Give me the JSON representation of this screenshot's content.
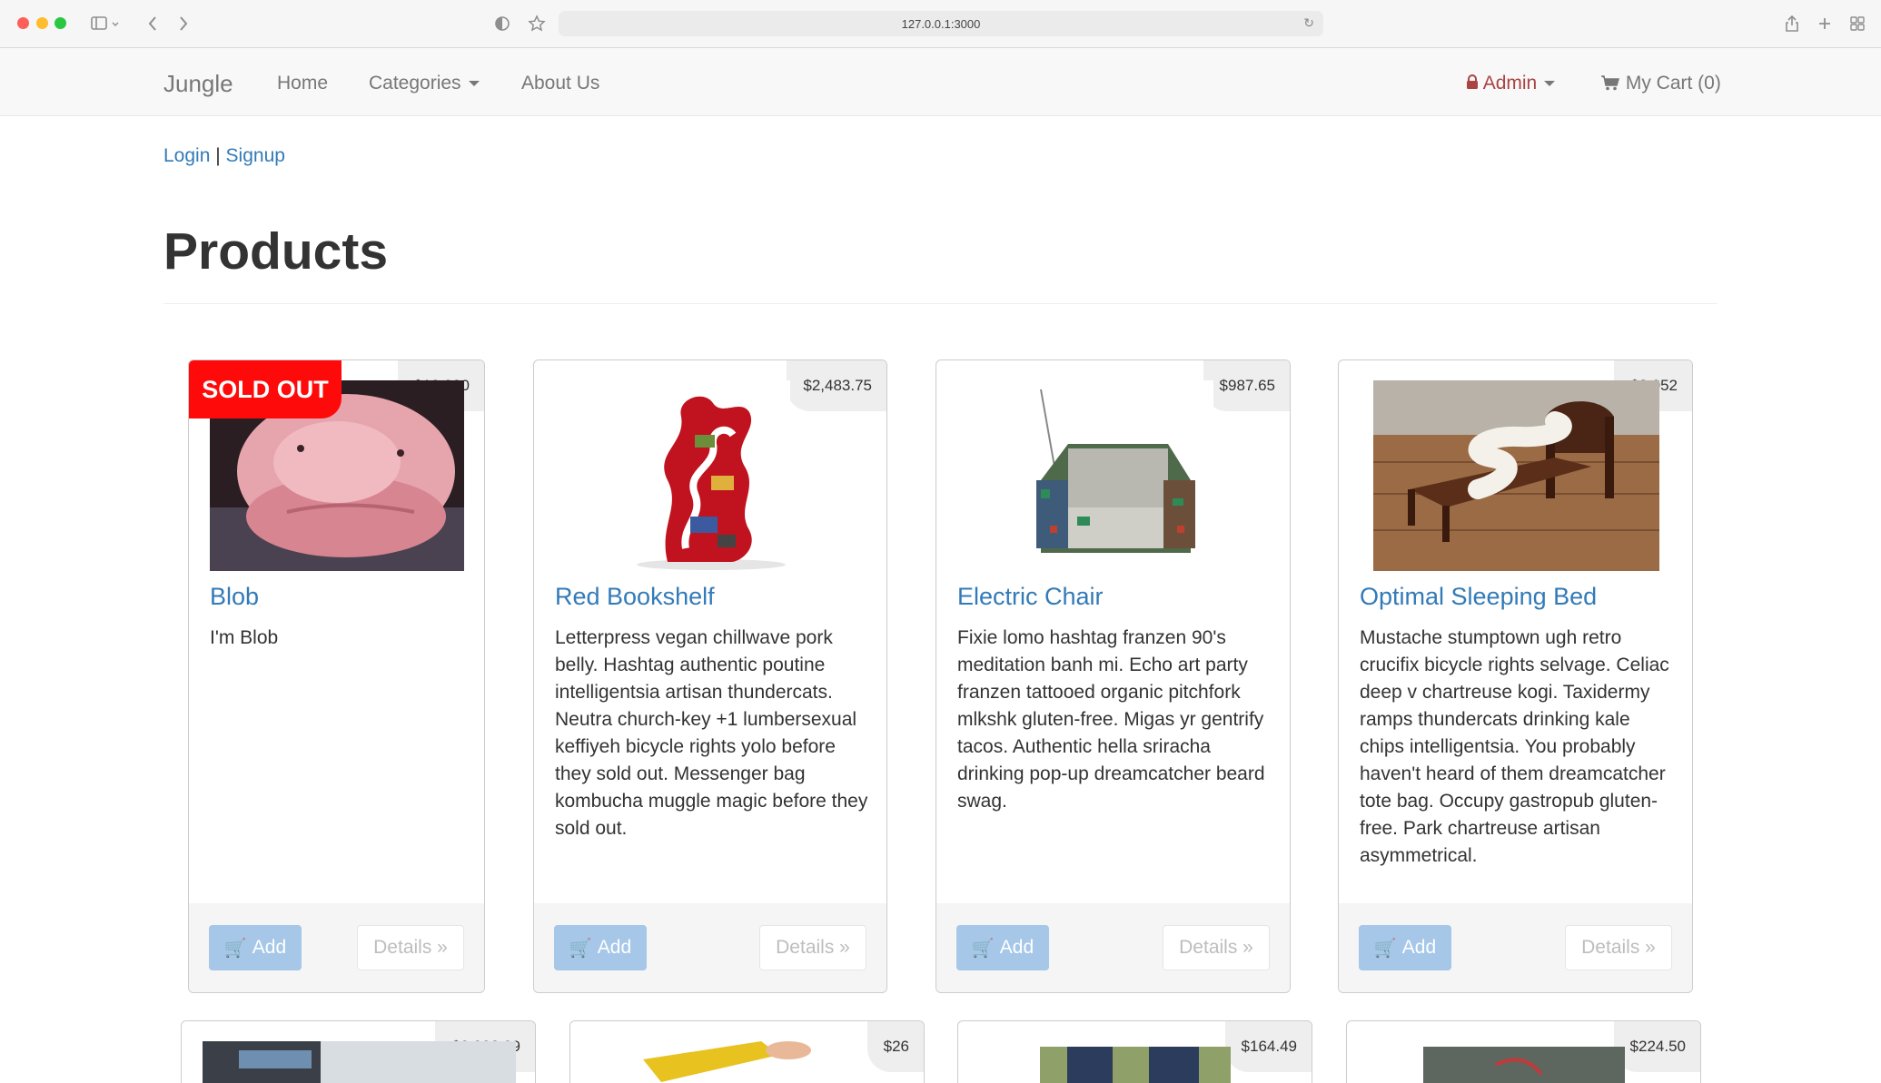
{
  "browser": {
    "url": "127.0.0.1:3000"
  },
  "navbar": {
    "brand": "Jungle",
    "links": {
      "home": "Home",
      "categories": "Categories",
      "about": "About Us"
    },
    "admin": "Admin",
    "cart": "My Cart (0)"
  },
  "auth": {
    "login": "Login",
    "separator": "|",
    "signup": "Signup"
  },
  "page": {
    "title": "Products"
  },
  "products": [
    {
      "title": "Blob",
      "price": "$12,000",
      "badge": "SOLD OUT",
      "description": "I'm Blob",
      "add_label": "Add",
      "details_label": "Details »"
    },
    {
      "title": "Red Bookshelf",
      "price": "$2,483.75",
      "description": "Letterpress vegan chillwave pork belly. Hashtag authentic poutine intelligentsia artisan thundercats. Neutra church-key +1 lumbersexual keffiyeh bicycle rights yolo before they sold out. Messenger bag kombucha muggle magic before they sold out.",
      "add_label": "Add",
      "details_label": "Details »"
    },
    {
      "title": "Electric Chair",
      "price": "$987.65",
      "description": "Fixie lomo hashtag franzen 90's meditation banh mi. Echo art party franzen tattooed organic pitchfork mlkshk gluten-free. Migas yr gentrify tacos. Authentic hella sriracha drinking pop-up dreamcatcher beard swag.",
      "add_label": "Add",
      "details_label": "Details »"
    },
    {
      "title": "Optimal Sleeping Bed",
      "price": "$3,052",
      "description": "Mustache stumptown ugh retro crucifix bicycle rights selvage. Celiac deep v chartreuse kogi. Taxidermy ramps thundercats drinking kale chips intelligentsia. You probably haven't heard of them dreamcatcher tote bag. Occupy gastropub gluten-free. Park chartreuse artisan asymmetrical.",
      "add_label": "Add",
      "details_label": "Details »"
    }
  ],
  "products_row2": [
    {
      "price": "$2,026.29"
    },
    {
      "price": "$26"
    },
    {
      "price": "$164.49"
    },
    {
      "price": "$224.50"
    }
  ]
}
